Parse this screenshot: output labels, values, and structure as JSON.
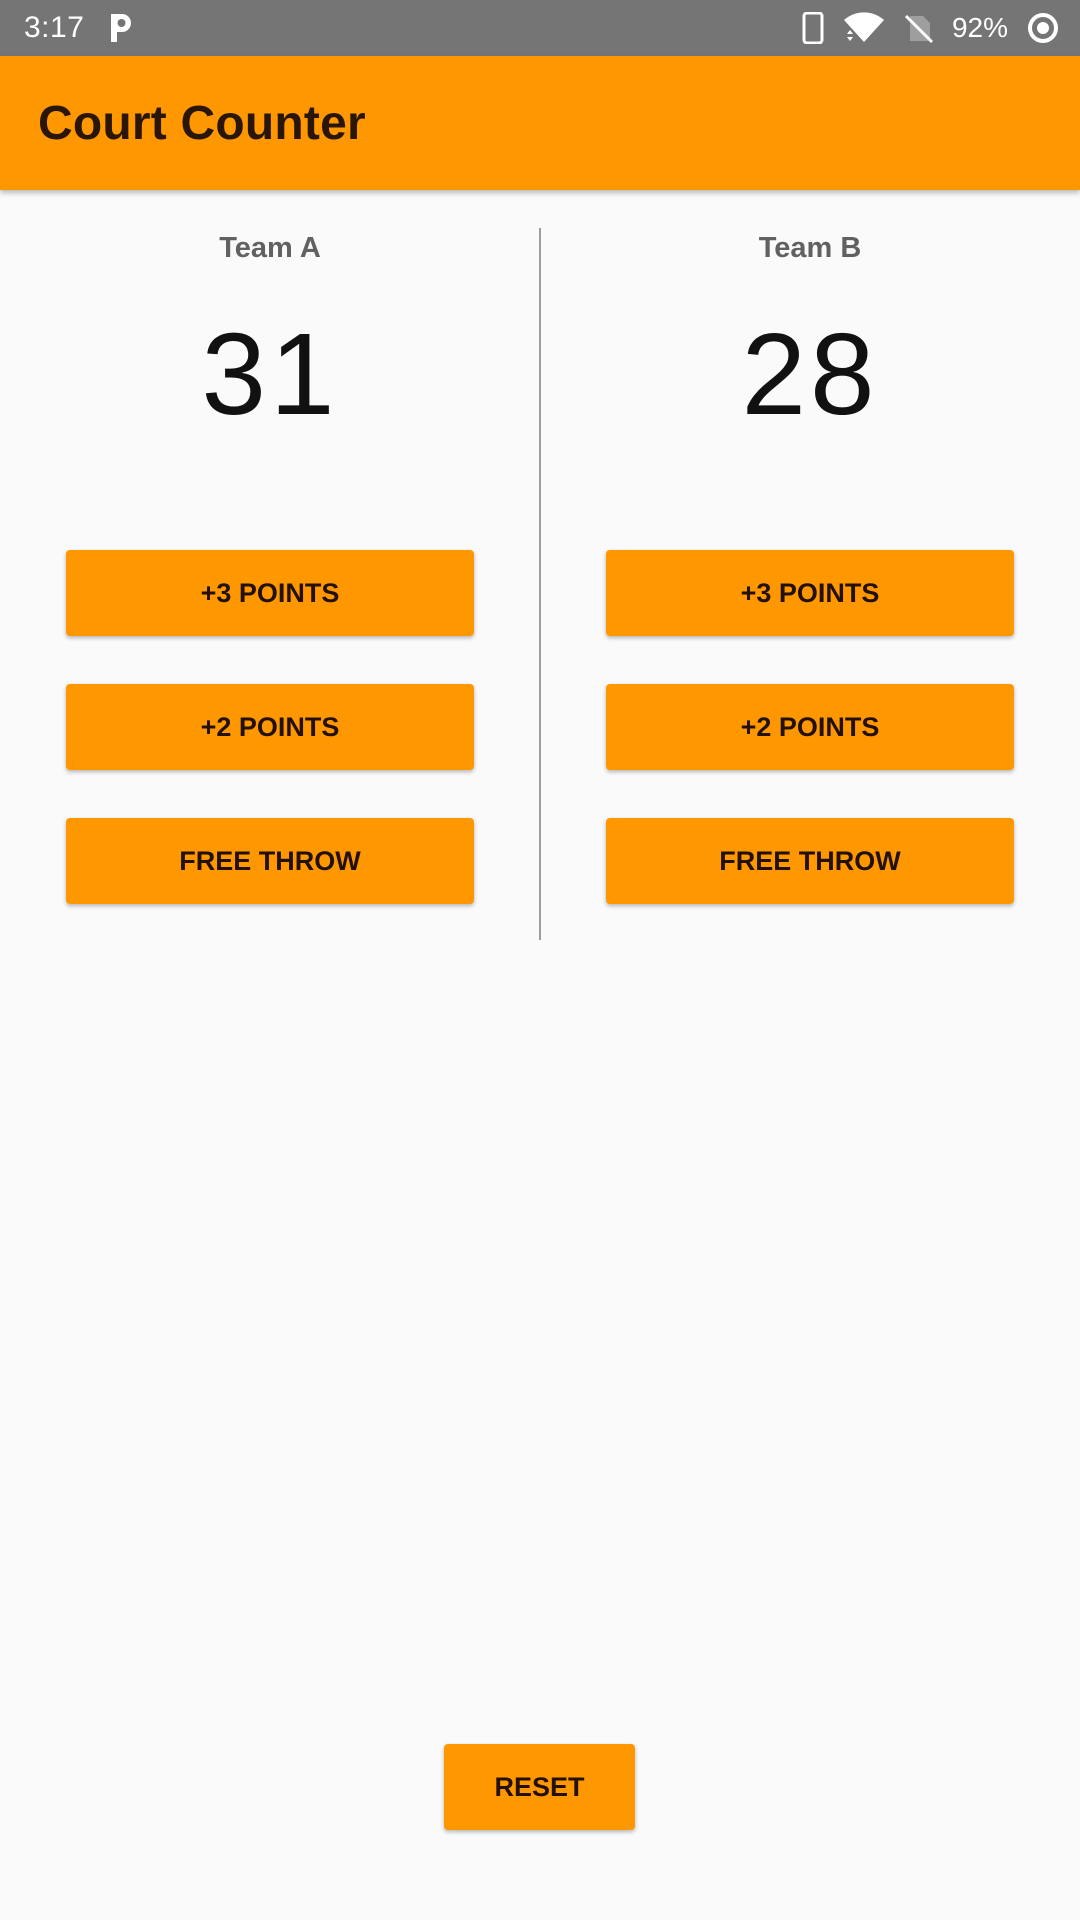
{
  "status_bar": {
    "time": "3:17",
    "battery": "92%",
    "icons": [
      "parking-icon",
      "phone-icon",
      "wifi-icon",
      "no-sim-icon",
      "sync-icon"
    ]
  },
  "app_bar": {
    "title": "Court Counter",
    "color": "#ff9800"
  },
  "team_a": {
    "name": "Team A",
    "score": "31",
    "buttons": {
      "plus3": "+3 POINTS",
      "plus2": "+2 POINTS",
      "free_throw": "FREE THROW"
    }
  },
  "team_b": {
    "name": "Team B",
    "score": "28",
    "buttons": {
      "plus3": "+3 POINTS",
      "plus2": "+2 POINTS",
      "free_throw": "FREE THROW"
    }
  },
  "reset_label": "RESET"
}
